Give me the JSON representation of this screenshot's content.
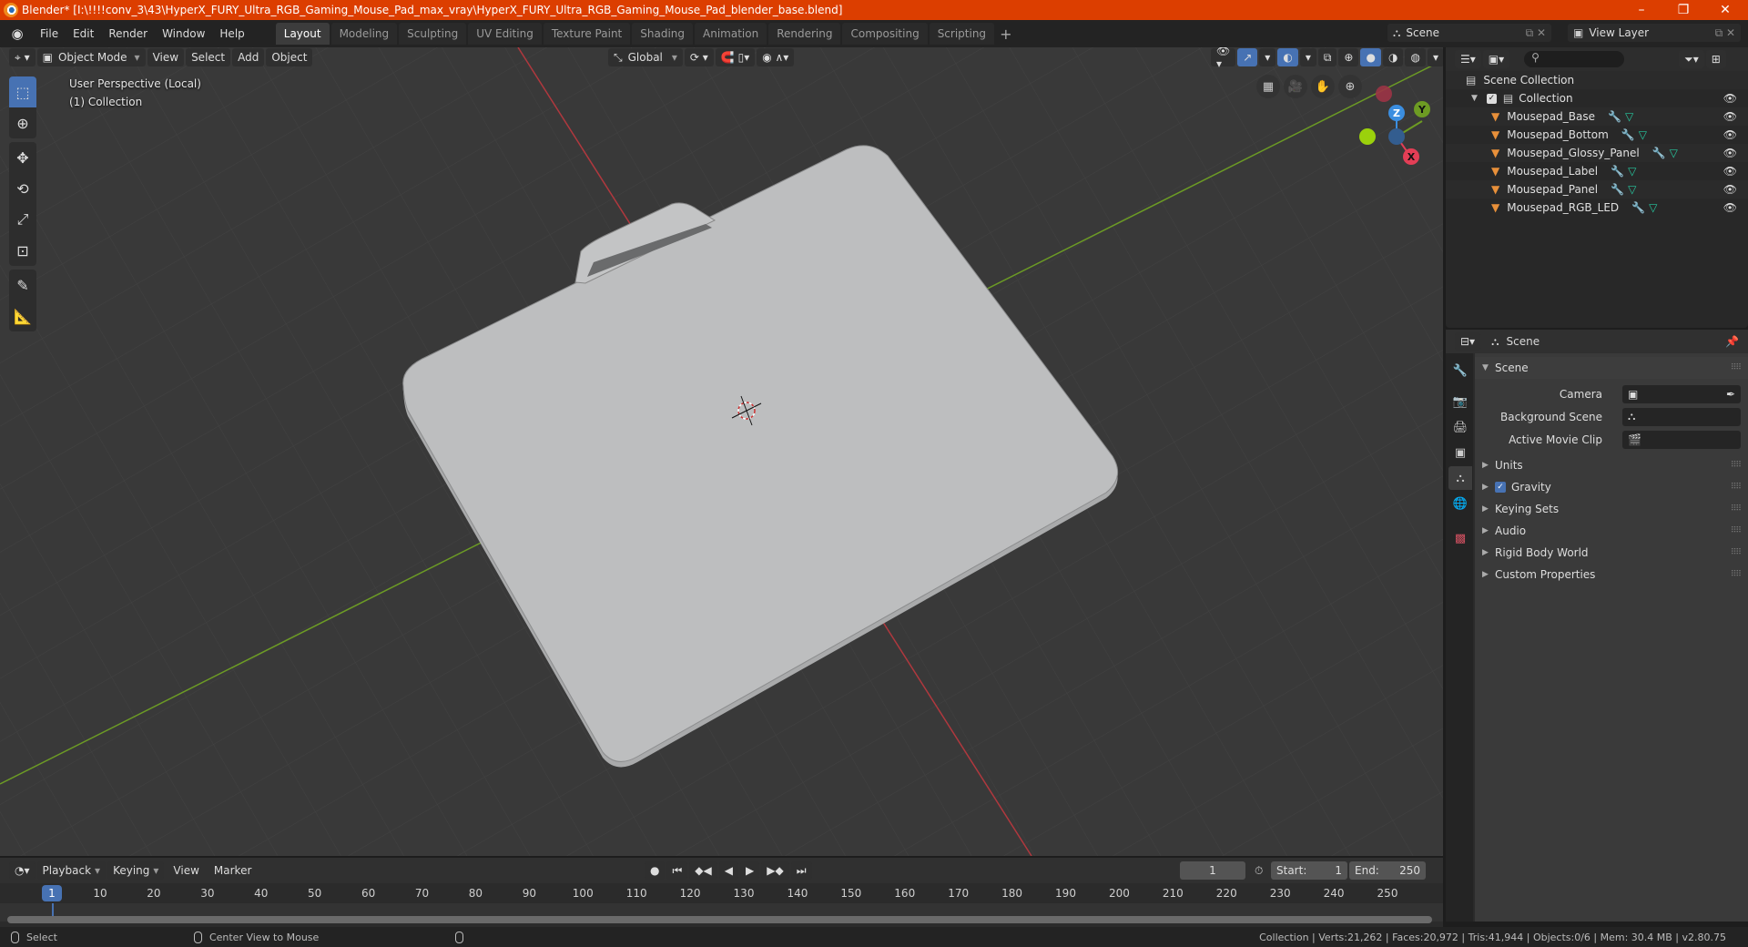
{
  "titlebar": {
    "title": "Blender* [I:\\!!!!conv_3\\43\\HyperX_FURY_Ultra_RGB_Gaming_Mouse_Pad_max_vray\\HyperX_FURY_Ultra_RGB_Gaming_Mouse_Pad_blender_base.blend]",
    "minimize": "–",
    "restore": "❐",
    "close": "✕"
  },
  "menubar": {
    "menus": [
      "File",
      "Edit",
      "Render",
      "Window",
      "Help"
    ],
    "workspaces": [
      "Layout",
      "Modeling",
      "Sculpting",
      "UV Editing",
      "Texture Paint",
      "Shading",
      "Animation",
      "Rendering",
      "Compositing",
      "Scripting"
    ],
    "active_workspace": "Layout",
    "add_workspace": "+",
    "scene": "Scene",
    "view_layer": "View Layer"
  },
  "viewport": {
    "mode": "Object Mode",
    "menus": [
      "View",
      "Select",
      "Add",
      "Object"
    ],
    "transform_orientation": "Global",
    "info_line1": "User Perspective (Local)",
    "info_line2": "(1) Collection",
    "gizmo": {
      "x": "X",
      "y": "Y",
      "z": "Z"
    },
    "colors": {
      "x_axis": "#b0383e",
      "y_axis": "#6c9b25",
      "pad": "#bdbebf",
      "background": "#393939"
    }
  },
  "toolbar": {
    "tools": [
      "select-box",
      "cursor",
      "move",
      "rotate",
      "scale",
      "transform",
      "annotate",
      "measure"
    ],
    "active": "select-box"
  },
  "outliner": {
    "root": "Scene Collection",
    "collection": "Collection",
    "items": [
      {
        "name": "Mousepad_Base"
      },
      {
        "name": "Mousepad_Bottom"
      },
      {
        "name": "Mousepad_Glossy_Panel"
      },
      {
        "name": "Mousepad_Label"
      },
      {
        "name": "Mousepad_Panel"
      },
      {
        "name": "Mousepad_RGB_LED"
      }
    ]
  },
  "properties": {
    "context": "Scene",
    "panel": "Scene",
    "fields": [
      {
        "label": "Camera",
        "value": ""
      },
      {
        "label": "Background Scene",
        "value": ""
      },
      {
        "label": "Active Movie Clip",
        "value": ""
      }
    ],
    "subpanels": [
      "Units",
      "Gravity",
      "Keying Sets",
      "Audio",
      "Rigid Body World",
      "Custom Properties"
    ],
    "gravity_enabled": true
  },
  "timeline": {
    "menus": [
      "Playback",
      "Keying",
      "View",
      "Marker"
    ],
    "current_frame": "1",
    "start_label": "Start:",
    "start": "1",
    "end_label": "End:",
    "end": "250",
    "ticks": [
      "10",
      "20",
      "30",
      "40",
      "50",
      "60",
      "70",
      "80",
      "90",
      "100",
      "110",
      "120",
      "130",
      "140",
      "150",
      "160",
      "170",
      "180",
      "190",
      "200",
      "210",
      "220",
      "230",
      "240",
      "250"
    ],
    "playhead": "1"
  },
  "statusbar": {
    "left_action": "Select",
    "middle_action": "Center View to Mouse",
    "stats": "Collection | Verts:21,262 | Faces:20,972 | Tris:41,944 | Objects:0/6 | Mem: 30.4 MB | v2.80.75"
  }
}
